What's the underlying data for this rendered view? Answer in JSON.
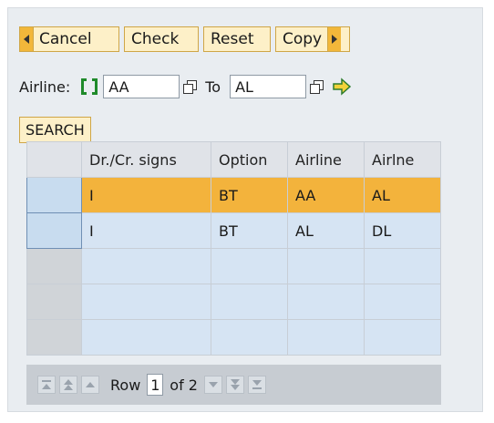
{
  "toolbar": {
    "cancel": "Cancel",
    "check": "Check",
    "reset": "Reset",
    "copy": "Copy"
  },
  "filter": {
    "label": "Airline:",
    "from_value": "AA",
    "to_label": "To",
    "to_value": "AL"
  },
  "search_label": "SEARCH",
  "table": {
    "columns": [
      "Dr./Cr. signs",
      "Option",
      "Airline",
      "Airlne"
    ],
    "rows": [
      [
        "I",
        "BT",
        "AA",
        "AL"
      ],
      [
        "I",
        "BT",
        "AL",
        "DL"
      ],
      [
        "",
        "",
        "",
        ""
      ],
      [
        "",
        "",
        "",
        ""
      ],
      [
        "",
        "",
        "",
        ""
      ]
    ]
  },
  "pager": {
    "row_label": "Row",
    "current_row": "1",
    "of_label": "of 2"
  },
  "colors": {
    "button_bg": "#fdf0c8",
    "button_accent": "#f2b73a",
    "selected_row": "#f3b33c",
    "data_row": "#d6e4f3",
    "select_icon": "#1f8a2a"
  }
}
